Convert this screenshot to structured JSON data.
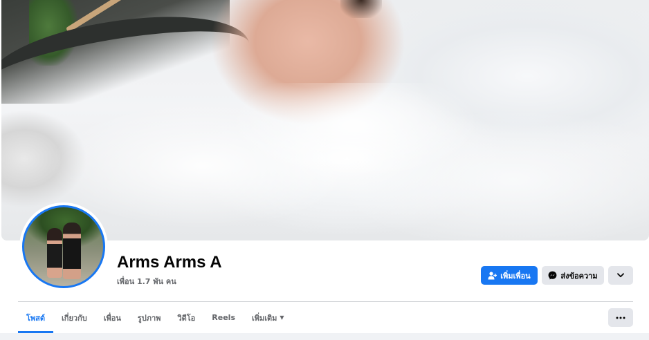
{
  "profile": {
    "name": "Arms Arms A",
    "friend_count": "เพื่อน 1.7 พัน คน"
  },
  "actions": {
    "add_friend_label": "เพิ่มเพื่อน",
    "message_label": "ส่งข้อความ"
  },
  "tabs": [
    {
      "label": "โพสต์",
      "active": true
    },
    {
      "label": "เกี่ยวกับ",
      "active": false
    },
    {
      "label": "เพื่อน",
      "active": false
    },
    {
      "label": "รูปภาพ",
      "active": false
    },
    {
      "label": "วิดีโอ",
      "active": false
    },
    {
      "label": "Reels",
      "active": false
    },
    {
      "label": "เพิ่มเติม",
      "active": false
    }
  ],
  "colors": {
    "accent": "#1877f2",
    "secondary_button": "#e4e6eb",
    "muted_text": "#65676b"
  },
  "icons": {
    "add_friend": "person-plus-icon",
    "message": "messenger-icon",
    "more": "chevron-down-icon",
    "overflow": "ellipsis-icon",
    "tab_more_caret": "caret-down-icon"
  }
}
